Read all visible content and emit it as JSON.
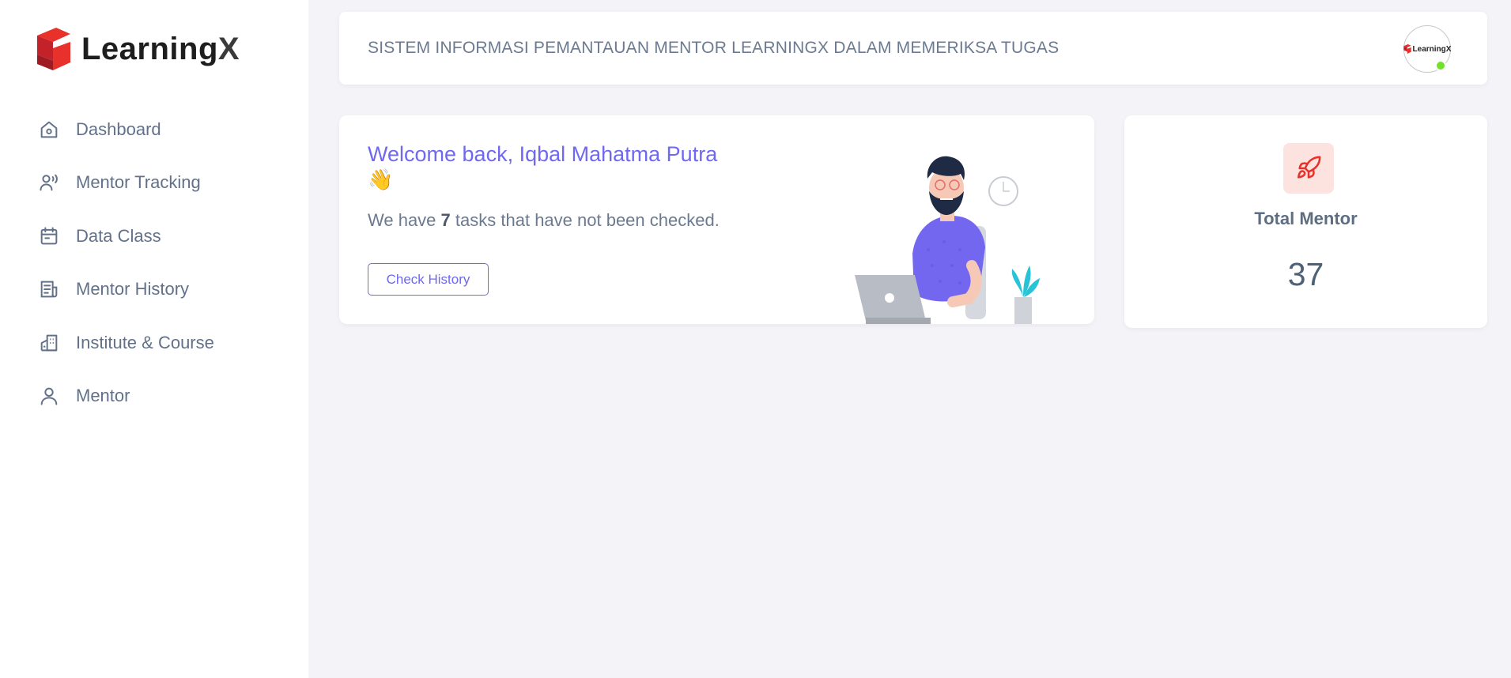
{
  "brand": {
    "name": "Learning",
    "name_x": "X"
  },
  "sidebar": {
    "items": [
      {
        "label": "Dashboard",
        "icon": "home-icon"
      },
      {
        "label": "Mentor Tracking",
        "icon": "user-signal-icon"
      },
      {
        "label": "Data Class",
        "icon": "calendar-icon"
      },
      {
        "label": "Mentor History",
        "icon": "document-history-icon"
      },
      {
        "label": "Institute & Course",
        "icon": "building-icon"
      },
      {
        "label": "Mentor",
        "icon": "user-icon"
      }
    ]
  },
  "header": {
    "title": "SISTEM INFORMASI PEMANTAUAN MENTOR LEARNINGX DALAM MEMERIKSA TUGAS",
    "avatar_text": "LearningX",
    "status_color": "#72e128"
  },
  "welcome": {
    "title": "Welcome back, Iqbal Mahatma Putra",
    "emoji": "👋",
    "text_prefix": "We have",
    "task_count": "7",
    "text_suffix": "tasks that have not been checked.",
    "button_label": "Check History"
  },
  "stat": {
    "label": "Total Mentor",
    "value": "37",
    "icon": "rocket-icon"
  },
  "colors": {
    "accent": "#6f68f0",
    "brand_red": "#e8312a",
    "background": "#f4f4f8"
  }
}
